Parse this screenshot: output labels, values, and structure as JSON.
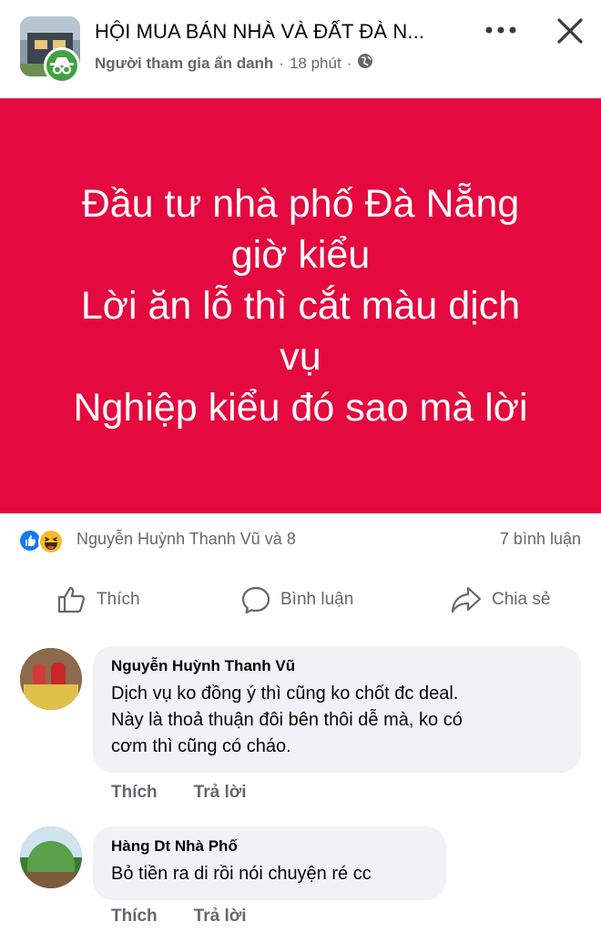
{
  "header": {
    "group_title": "HỘI MUA BÁN NHÀ VÀ ĐẤT ĐÀ N...",
    "poster": "Người tham gia ẩn danh",
    "separator": "·",
    "time": "18 phút",
    "privacy_icon": "globe-icon",
    "more_icon": "more-horizontal-icon",
    "close_icon": "close-icon"
  },
  "post": {
    "background_color": "#e4093f",
    "text": "Đầu tư nhà phố Đà Nẵng\ngiờ kiểu\nLời ăn lỗ thì cắt màu dịch\nvụ\nNghiệp kiểu đó sao mà lời"
  },
  "reactions": {
    "icons": [
      "like-reaction-icon",
      "haha-reaction-icon"
    ],
    "names": "Nguyễn Huỳnh Thanh Vũ và 8",
    "comment_count": "7 bình luận"
  },
  "actions": {
    "like": "Thích",
    "comment": "Bình luận",
    "share": "Chia sẻ"
  },
  "comments": [
    {
      "name": "Nguyễn Huỳnh Thanh Vũ",
      "text": "Dịch vụ ko đồng ý thì cũng ko chốt đc deal.\nNày là thoả thuận đôi bên thôi dễ mà, ko có\ncơm thì cũng có cháo.",
      "like": "Thích",
      "reply": "Trả lời"
    },
    {
      "name": "Hàng Dt Nhà Phố",
      "text": "Bỏ tiền ra di rồi nói chuyện ré cc",
      "like": "Thích",
      "reply": "Trả lời"
    }
  ],
  "colors": {
    "secondary_text": "#65676b",
    "bubble_bg": "#f0f2f5",
    "anon_badge": "#42a23f",
    "like_blue": "#1877f2"
  }
}
